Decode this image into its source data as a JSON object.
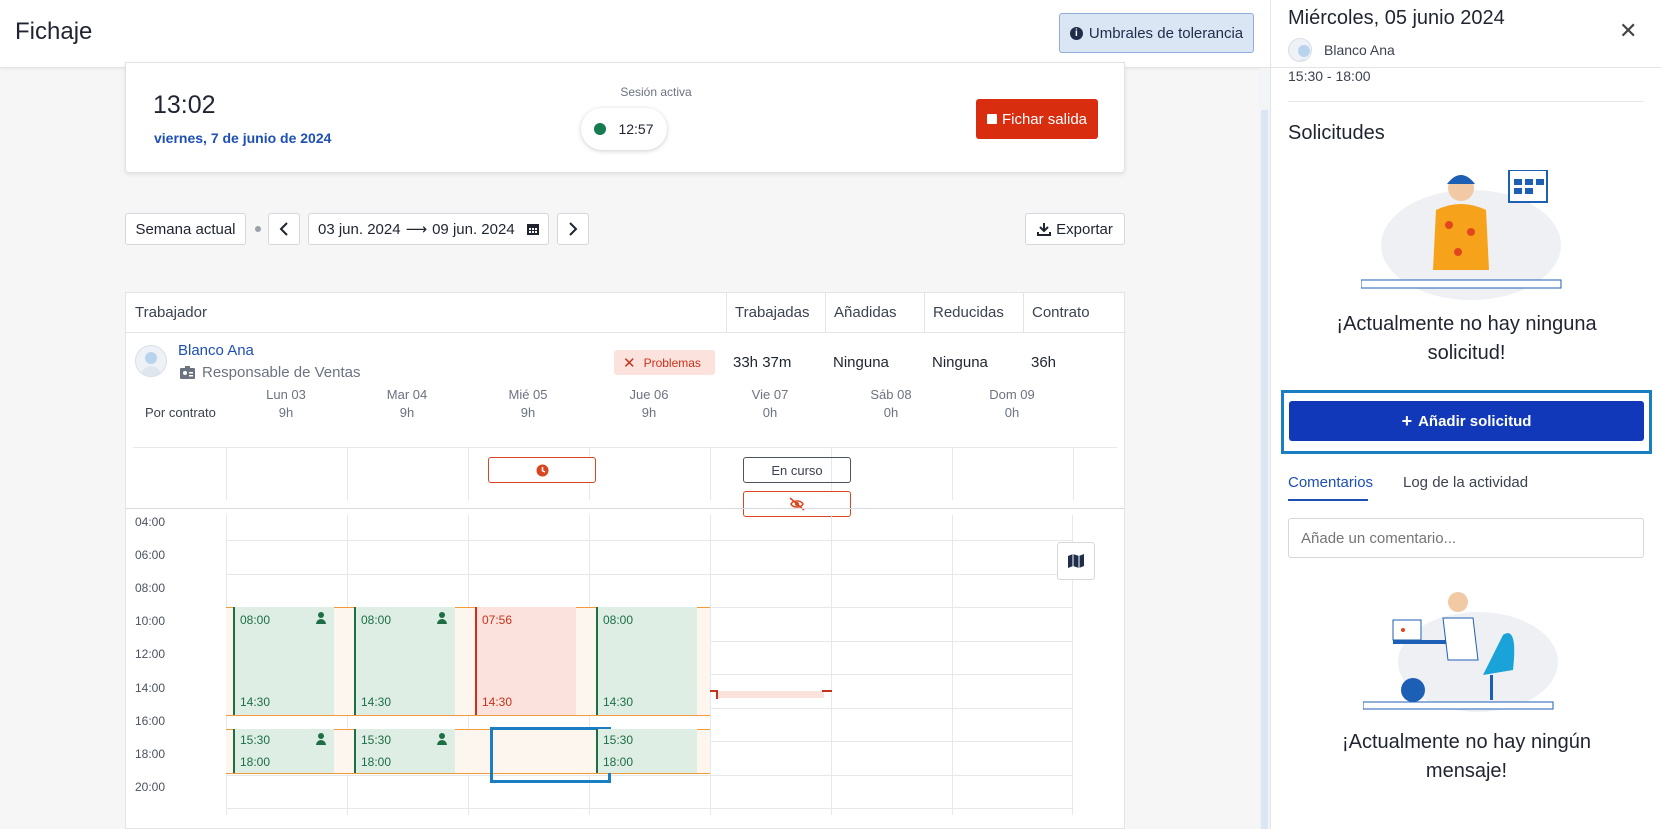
{
  "header": {
    "title": "Fichaje",
    "tolerance_button": "Umbrales de tolerancia"
  },
  "session": {
    "time": "13:02",
    "date": "viernes, 7 de junio de 2024",
    "active_label": "Sesión activa",
    "active_time": "12:57",
    "clock_out_button": "Fichar salida"
  },
  "toolbar": {
    "current_week": "Semana actual",
    "range_start": "03 jun. 2024",
    "range_arrow": "⟶",
    "range_end": "09 jun. 2024",
    "export_button": "Exportar"
  },
  "table": {
    "headers": [
      "Trabajador",
      "Trabajadas",
      "Añadidas",
      "Reducidas",
      "Contrato"
    ],
    "worker": {
      "name": "Blanco Ana",
      "role": "Responsable de Ventas",
      "status_badge": "Problemas",
      "worked": "33h 37m",
      "added": "Ninguna",
      "reduced": "Ninguna",
      "contract": "36h"
    },
    "by_contract_label": "Por contrato",
    "days": [
      {
        "name": "Lun 03",
        "hours": "9h"
      },
      {
        "name": "Mar 04",
        "hours": "9h"
      },
      {
        "name": "Mié 05",
        "hours": "9h"
      },
      {
        "name": "Jue 06",
        "hours": "9h"
      },
      {
        "name": "Vie 07",
        "hours": "0h"
      },
      {
        "name": "Sáb 08",
        "hours": "0h"
      },
      {
        "name": "Dom 09",
        "hours": "0h"
      }
    ],
    "in_progress_label": "En curso",
    "hour_labels": [
      "04:00",
      "06:00",
      "08:00",
      "10:00",
      "12:00",
      "14:00",
      "16:00",
      "18:00",
      "20:00"
    ],
    "shifts": [
      {
        "start": "08:00",
        "end": "14:30",
        "person_icon": true
      },
      {
        "start": "08:00",
        "end": "14:30",
        "person_icon": true
      },
      {
        "start": "07:56",
        "end": "14:30",
        "person_icon": false
      },
      {
        "start": "08:00",
        "end": "14:30",
        "person_icon": false
      },
      {
        "start": "15:30",
        "end": "18:00",
        "person_icon": true
      },
      {
        "start": "15:30",
        "end": "18:00",
        "person_icon": true
      },
      {
        "start": "15:30",
        "end": "18:00",
        "person_icon": false
      }
    ]
  },
  "panel": {
    "title": "Miércoles, 05 junio 2024",
    "user": "Blanco Ana",
    "schedule": "15:30 - 18:00",
    "requests_title": "Solicitudes",
    "no_requests": "¡Actualmente no hay ninguna solicitud!",
    "add_request_button": "Añadir solicitud",
    "tab_comments": "Comentarios",
    "tab_activity": "Log de la actividad",
    "comment_placeholder": "Añade un comentario...",
    "no_messages": "¡Actualmente no hay ningún mensaje!"
  },
  "colors": {
    "accent_blue": "#1038b8",
    "danger": "#d92d0f",
    "shift_green": "#dfeee5",
    "shift_problem": "#fbe2dc",
    "selection_blue": "#1a7fc2"
  }
}
